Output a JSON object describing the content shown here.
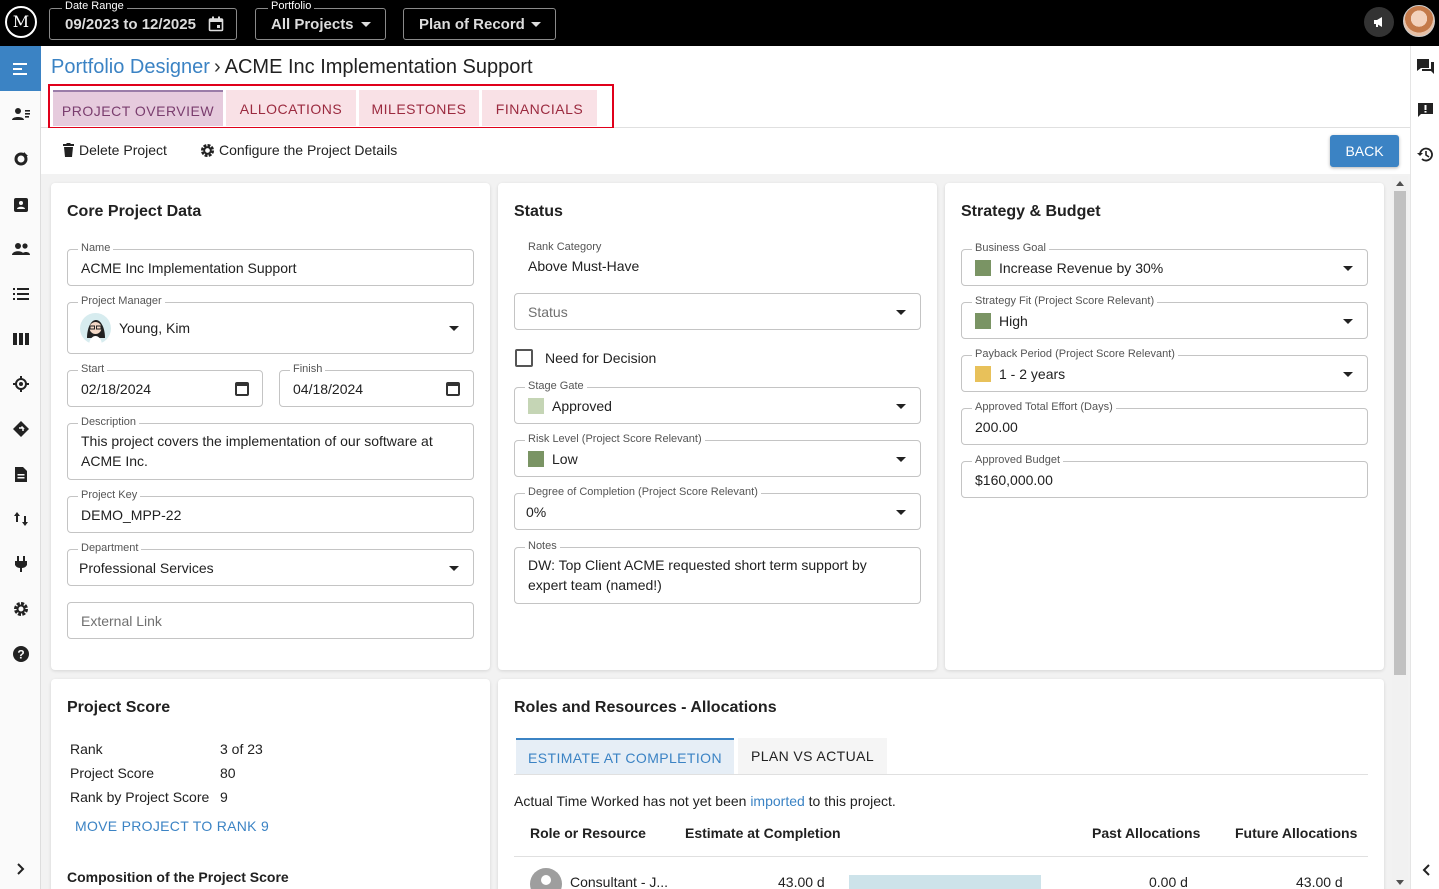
{
  "topbar": {
    "logo_text": "M",
    "date_range": {
      "label": "Date Range",
      "value": "09/2023 to 12/2025"
    },
    "portfolio": {
      "label": "Portfolio",
      "value": "All Projects"
    },
    "plan": {
      "value": "Plan of Record"
    },
    "icons": [
      "megaphone-icon",
      "user-avatar"
    ]
  },
  "sidebar": {
    "icons": [
      "menu-icon",
      "resources-icon",
      "refresh-icon",
      "assignment-icon",
      "people-icon",
      "list-icon",
      "columns-icon",
      "target-icon",
      "roadmap-icon",
      "document-icon",
      "sort-icon",
      "plug-icon",
      "settings-icon",
      "help-icon",
      "chevron-right-icon"
    ]
  },
  "rightbar": {
    "icons": [
      "chat-icon",
      "feedback-icon",
      "history-icon",
      "chevron-left-icon"
    ]
  },
  "breadcrumb": {
    "parent": "Portfolio Designer",
    "separator": "›",
    "current": "ACME Inc Implementation Support"
  },
  "tabs": [
    "PROJECT OVERVIEW",
    "ALLOCATIONS",
    "MILESTONES",
    "FINANCIALS"
  ],
  "toolbar": {
    "delete": "Delete Project",
    "configure": "Configure the Project Details",
    "back": "BACK"
  },
  "core": {
    "title": "Core Project Data",
    "name": {
      "label": "Name",
      "value": "ACME Inc Implementation Support"
    },
    "manager": {
      "label": "Project Manager",
      "value": "Young, Kim"
    },
    "start": {
      "label": "Start",
      "value": "02/18/2024"
    },
    "finish": {
      "label": "Finish",
      "value": "04/18/2024"
    },
    "description": {
      "label": "Description",
      "line1": "This project covers the implementation of our software at",
      "line2": "ACME Inc."
    },
    "key": {
      "label": "Project Key",
      "value": "DEMO_MPP-22"
    },
    "department": {
      "label": "Department",
      "value": "Professional Services"
    },
    "external_link": {
      "placeholder": "External Link"
    }
  },
  "status": {
    "title": "Status",
    "rank_category": {
      "label": "Rank Category",
      "value": "Above Must-Have"
    },
    "status": {
      "placeholder": "Status"
    },
    "need_decision": "Need for Decision",
    "stage_gate": {
      "label": "Stage Gate",
      "value": "Approved",
      "color": "#c5d5b5"
    },
    "risk": {
      "label": "Risk Level (Project Score Relevant)",
      "value": "Low",
      "color": "#7a9464"
    },
    "completion": {
      "label": "Degree of Completion (Project Score Relevant)",
      "value": "0%"
    },
    "notes": {
      "label": "Notes",
      "line1": "DW: Top Client ACME requested short term support by",
      "line2": "expert team (named!)"
    }
  },
  "strategy": {
    "title": "Strategy & Budget",
    "goal": {
      "label": "Business Goal",
      "value": "Increase Revenue by 30%",
      "color": "#7a9464"
    },
    "fit": {
      "label": "Strategy Fit (Project Score Relevant)",
      "value": "High",
      "color": "#7a9464"
    },
    "payback": {
      "label": "Payback Period (Project Score Relevant)",
      "value": "1 - 2 years",
      "color": "#e8c15a"
    },
    "effort": {
      "label": "Approved Total Effort (Days)",
      "value": "200.00"
    },
    "budget": {
      "label": "Approved Budget",
      "value": "$160,000.00"
    }
  },
  "score": {
    "title": "Project Score",
    "rank_label": "Rank",
    "rank_value": "3 of 23",
    "score_label": "Project Score",
    "score_value": "80",
    "rank_by_label": "Rank by Project Score",
    "rank_by_value": "9",
    "move": "MOVE PROJECT TO RANK 9",
    "composition": "Composition of the Project Score"
  },
  "roles": {
    "title": "Roles and Resources - Allocations",
    "tab_active": "ESTIMATE AT COMPLETION",
    "tab_other": "PLAN VS ACTUAL",
    "notice_before": "Actual Time Worked has not yet been",
    "notice_link": "imported",
    "notice_after": "to this project.",
    "headers": [
      "Role or Resource",
      "Estimate at Completion",
      "Past Allocations",
      "Future Allocations"
    ],
    "row": {
      "name": "Consultant - J...",
      "estimate": "43.00 d",
      "past": "0.00 d",
      "future": "43.00 d",
      "bar_fraction": 1.0
    }
  }
}
